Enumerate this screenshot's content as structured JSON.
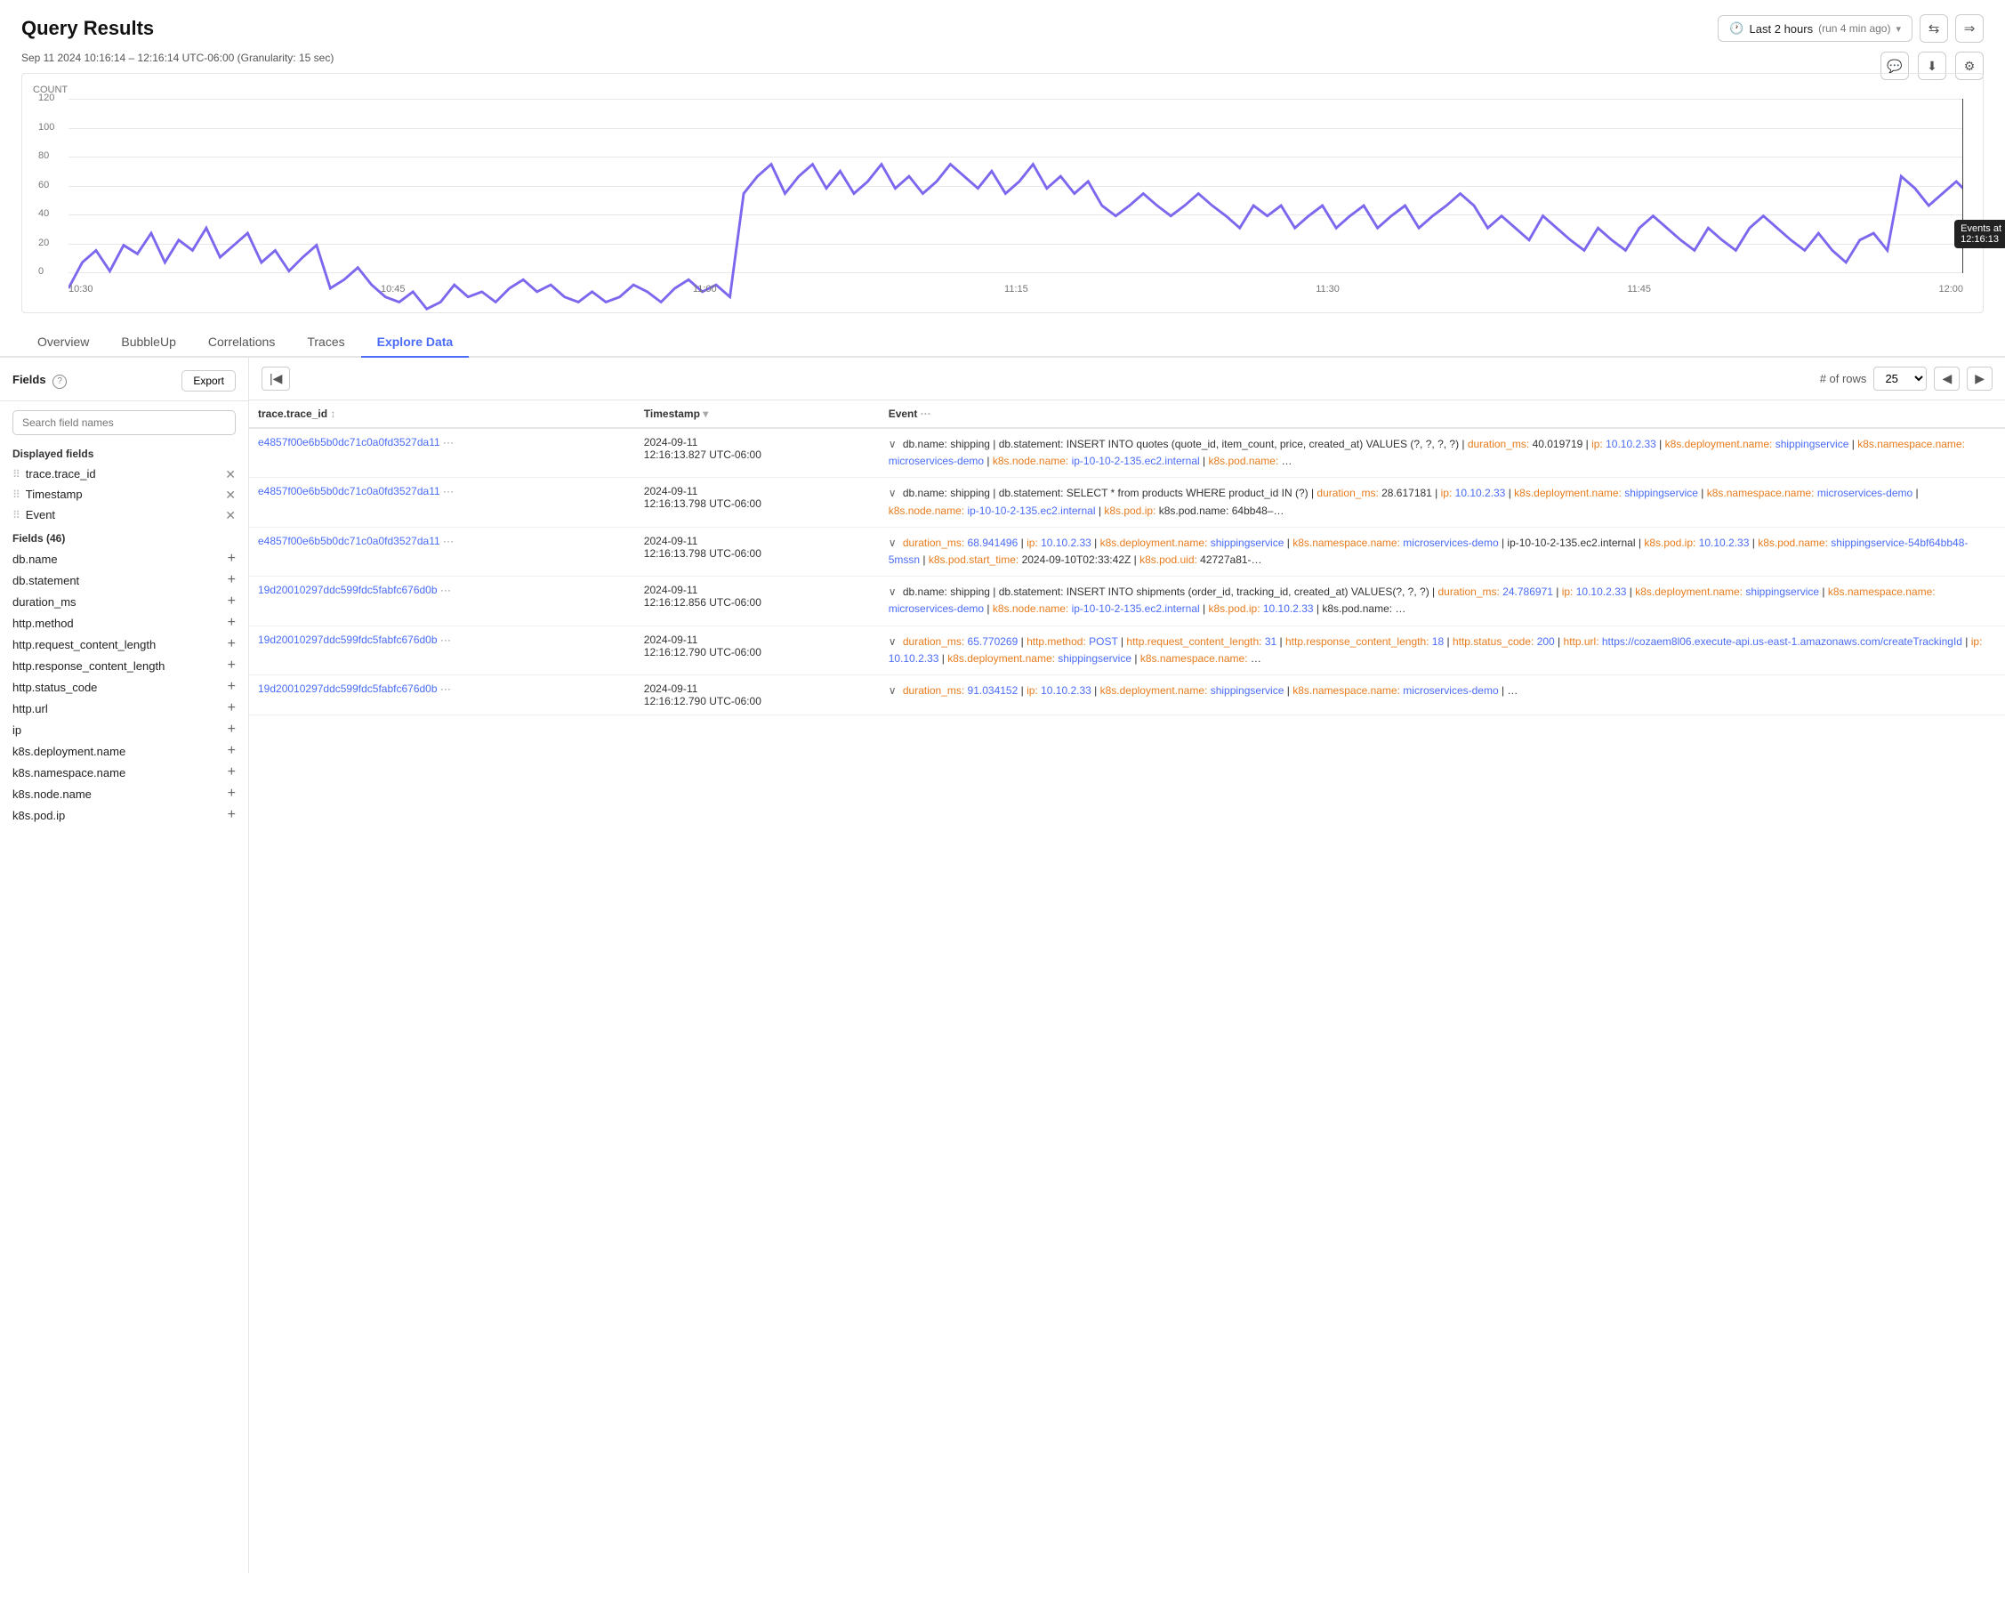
{
  "header": {
    "title": "Query Results",
    "time_range": "Last 2 hours",
    "time_suffix": "(run 4 min ago)",
    "subtitle": "Sep 11 2024 10:16:14 – 12:16:14 UTC-06:00 (Granularity: 15 sec)"
  },
  "chart": {
    "y_label": "COUNT",
    "y_ticks": [
      "120",
      "100",
      "80",
      "60",
      "40",
      "20",
      "0"
    ],
    "x_labels": [
      "10:30",
      "10:45",
      "11:00",
      "11:15",
      "11:30",
      "11:45",
      "12:00"
    ],
    "tooltip": {
      "label": "Events at",
      "time": "12:16:13"
    }
  },
  "tabs": [
    {
      "label": "Overview",
      "active": false
    },
    {
      "label": "BubbleUp",
      "active": false
    },
    {
      "label": "Correlations",
      "active": false
    },
    {
      "label": "Traces",
      "active": false
    },
    {
      "label": "Explore Data",
      "active": true
    }
  ],
  "fields_panel": {
    "title": "Fields",
    "export_label": "Export",
    "search_placeholder": "Search field names",
    "displayed_section": "Displayed fields",
    "displayed_fields": [
      {
        "name": "trace.trace_id"
      },
      {
        "name": "Timestamp"
      },
      {
        "name": "Event"
      }
    ],
    "available_section_prefix": "Fields",
    "available_count": "46",
    "available_fields": [
      "db.name",
      "db.statement",
      "duration_ms",
      "http.method",
      "http.request_content_length",
      "http.response_content_length",
      "http.status_code",
      "http.url",
      "ip",
      "k8s.deployment.name",
      "k8s.namespace.name",
      "k8s.node.name",
      "k8s.pod.ip"
    ]
  },
  "table": {
    "rows_label": "# of rows",
    "rows_value": "25",
    "columns": [
      {
        "key": "trace_id",
        "label": "trace.trace_id ↕"
      },
      {
        "key": "timestamp",
        "label": "Timestamp ▾"
      },
      {
        "key": "event",
        "label": "Event ···"
      }
    ],
    "rows": [
      {
        "trace_id": "e4857f00e6b5b0dc71c0a0fd3527da11",
        "timestamp": "2024-09-11\n12:16:13.827 UTC-06:00",
        "event": "db.name: shipping | db.statement: INSERT INTO quotes (quote_id, item_count, price, created_at) VALUES (?, ?, ?, ?) | duration_ms: 40.019719 | ip: 10.10.2.33 | k8s.deployment.name: shippingservice | k8s.namespace.name: microservices-demo | k8s.node.name: ip-10-10-2-135.ec2.internal | k8s.pod.ip: …",
        "highlight_keys": [
          "duration_ms",
          "ip",
          "k8s.deployment.name",
          "k8s.namespace.name",
          "k8s.node.name",
          "k8s.pod.ip"
        ]
      },
      {
        "trace_id": "e4857f00e6b5b0dc71c0a0fd3527da11",
        "timestamp": "2024-09-11\n12:16:13.798 UTC-06:00",
        "event": "db.name: shipping | db.statement: SELECT * from products WHERE product_id IN (?) | duration_ms: 28.617181 | ip: 10.10.2.33 | k8s.deployment.name: shippingservice | k8s.namespace.name: microservices-demo | k8s.node.name: ip-10-10-2-135.ec2.internal | k8s.pod.ip: k8s.pod.name: 64bb48–…",
        "highlight_keys": [
          "duration_ms",
          "ip",
          "k8s.deployment.name",
          "k8s.namespace.name",
          "k8s.node.name",
          "k8s.pod.ip"
        ]
      },
      {
        "trace_id": "e4857f00e6b5b0dc71c0a0fd3527da11",
        "timestamp": "2024-09-11\n12:16:13.798 UTC-06:00",
        "event": "duration_ms: 68.941496 | ip: 10.10.2.33 | k8s.deployment.name: shippingservice | k8s.namespace.name: microservices-demo | ip-10-10-2-135.ec2.internal | k8s.pod.ip: 10.10.2.33 | k8s.pod.name: shippingservice-54bf64bb48-5mssn | k8s.pod.start_time: 2024-09-10T02:33:42Z | k8s.pod.uid: 42727a81-…",
        "highlight_keys": [
          "duration_ms",
          "ip",
          "k8s.deployment.name",
          "k8s.namespace.name",
          "k8s.pod.ip",
          "k8s.pod.name",
          "k8s.pod.start_time",
          "k8s.pod.uid"
        ]
      },
      {
        "trace_id": "19d20010297ddc599fdc5fabfc676d0b",
        "timestamp": "2024-09-11\n12:16:12.856 UTC-06:00",
        "event": "db.name: shipping | db.statement: INSERT INTO shipments (order_id, tracking_id, created_at) VALUES(?, ?, ?) | duration_ms: 24.786971 | ip: 10.10.2.33 | k8s.deployment.name: shippingservice | k8s.namespace.name: microservices-demo | k8s.node.name: ip-10-10-2-135.ec2.internal | k8s.pod.ip: 10.10.2.33 | k8s.pod.name: …",
        "highlight_keys": [
          "duration_ms",
          "ip",
          "k8s.deployment.name",
          "k8s.namespace.name",
          "k8s.node.name",
          "k8s.pod.ip"
        ]
      },
      {
        "trace_id": "19d20010297ddc599fdc5fabfc676d0b",
        "timestamp": "2024-09-11\n12:16:12.790 UTC-06:00",
        "event": "duration_ms: 65.770269 | http.method: POST | http.request_content_length: 31 | http.response_content_length: 18 | http.status_code: 200 | http.url: https://cozaem8l06.execute-api.us-east-1.amazonaws.com/createTrackingId | ip: 10.10.2.33 | k8s.deployment.name: shippingservice | k8s.namespace.name: …",
        "highlight_keys": [
          "duration_ms",
          "http.method",
          "http.request_content_length",
          "http.response_content_length",
          "http.status_code",
          "http.url",
          "ip",
          "k8s.deployment.name",
          "k8s.namespace.name"
        ]
      },
      {
        "trace_id": "19d20010297ddc599fdc5fabfc676d0b",
        "timestamp": "2024-09-11\n12:16:12.790 UTC-06:00",
        "event": "duration_ms: 91.034152 | ip: 10.10.2.33 | k8s.deployment.name: shippingservice | k8s.namespace.name: microservices-demo | …",
        "highlight_keys": [
          "duration_ms",
          "ip",
          "k8s.deployment.name",
          "k8s.namespace.name"
        ]
      }
    ]
  }
}
